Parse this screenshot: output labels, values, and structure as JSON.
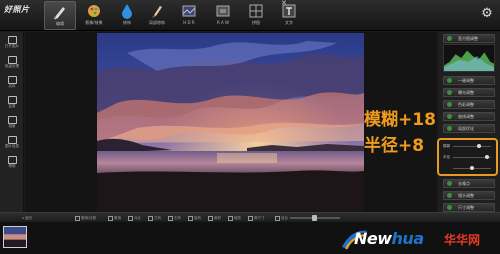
{
  "app": {
    "logo": "好照片"
  },
  "toolbar": {
    "items": [
      {
        "label": "编辑"
      },
      {
        "label": "影像/效果"
      },
      {
        "label": "修饰"
      },
      {
        "label": "局部修饰"
      },
      {
        "label": "H D R"
      },
      {
        "label": "R A W"
      },
      {
        "label": "拼图"
      },
      {
        "label": "文字"
      }
    ]
  },
  "leftbar": {
    "items": [
      {
        "label": "打开图片"
      },
      {
        "label": "批量处理"
      },
      {
        "label": "另存"
      },
      {
        "label": "复原"
      },
      {
        "label": "相册"
      },
      {
        "label": "图片信息"
      },
      {
        "label": "帮助"
      }
    ]
  },
  "rightpanel": {
    "buttons": [
      {
        "label": "直方图调整"
      },
      {
        "label": "一键调整"
      },
      {
        "label": "曝光调整"
      },
      {
        "label": "色彩调整"
      },
      {
        "label": "曲线调整"
      },
      {
        "label": "局部优化"
      },
      {
        "label": "去噪点"
      },
      {
        "label": "镜头调整"
      },
      {
        "label": "尺寸调整"
      }
    ],
    "sliders": [
      {
        "label": "模糊",
        "value": 0.72
      },
      {
        "label": "半径",
        "value": 0.95
      },
      {
        "label": "",
        "value": 0.5
      }
    ]
  },
  "annotations": {
    "line1": "模糊+18",
    "line2": "半径+8"
  },
  "bottombar": {
    "items": [
      {
        "label": "返回"
      },
      {
        "label": "撤销/还原"
      },
      {
        "label": "撤销"
      },
      {
        "label": "对比"
      },
      {
        "label": "左转"
      },
      {
        "label": "右转"
      },
      {
        "label": "旋转"
      },
      {
        "label": "裁剪"
      },
      {
        "label": "缩放"
      },
      {
        "label": "原尺寸"
      },
      {
        "label": "适合"
      }
    ]
  },
  "watermark": {
    "part1": "New",
    "part2": "hua",
    "cn": "华华网"
  },
  "colors": {
    "accent": "#f09b1c",
    "watermark_blue": "#1e74c8",
    "watermark_red": "#e63a27"
  }
}
